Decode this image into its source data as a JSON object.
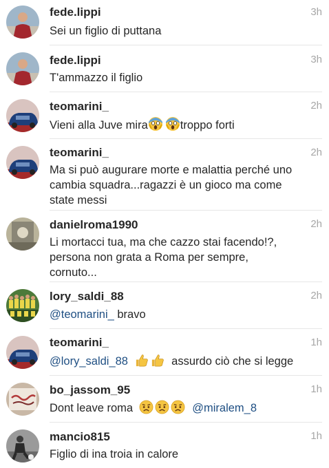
{
  "comments": [
    {
      "username": "fede.lippi",
      "time": "3h",
      "text": "Sei un figlio di puttana",
      "avatar": "red-jersey-player"
    },
    {
      "username": "fede.lippi",
      "time": "3h",
      "text": "T'ammazzo il figlio",
      "avatar": "red-jersey-player"
    },
    {
      "username": "teomarini_",
      "time": "2h",
      "text_pre": "Vieni alla Juve mira",
      "text_post": "troppo forti",
      "emoji": [
        "face-screaming-emoji",
        "face-screaming-emoji"
      ],
      "avatar": "blue-car"
    },
    {
      "username": "teomarini_",
      "time": "2h",
      "text": "Ma si può augurare morte e malattia perché uno\ncambia squadra...ragazzi è un gioco ma come\nstate messi",
      "avatar": "blue-car"
    },
    {
      "username": "danielroma1990",
      "time": "2h",
      "text": "Li mortacci tua, ma che cazzo stai facendo!?,\npersona non grata a Roma per sempre,\ncornuto...",
      "avatar": "grey-photo"
    },
    {
      "username": "lory_saldi_88",
      "time": "2h",
      "mention": "@teomarini_",
      "text_post": " bravo",
      "avatar": "team-photo"
    },
    {
      "username": "teomarini_",
      "time": "1h",
      "mention": "@lory_saldi_88",
      "text_post": "assurdo ciò che si legge",
      "emoji": [
        "thumbs-up-emoji",
        "thumbs-up-emoji"
      ],
      "avatar": "blue-car"
    },
    {
      "username": "bo_jassom_95",
      "time": "1h",
      "text_pre": "Dont leave roma",
      "emoji": [
        "worried-face-emoji",
        "worried-face-emoji",
        "worried-face-emoji"
      ],
      "mention": "@miralem_8",
      "avatar": "handwriting-photo"
    },
    {
      "username": "mancio815",
      "time": "1h",
      "text": "Figlio di ina troia in calore",
      "avatar": "football-bw-photo"
    }
  ]
}
